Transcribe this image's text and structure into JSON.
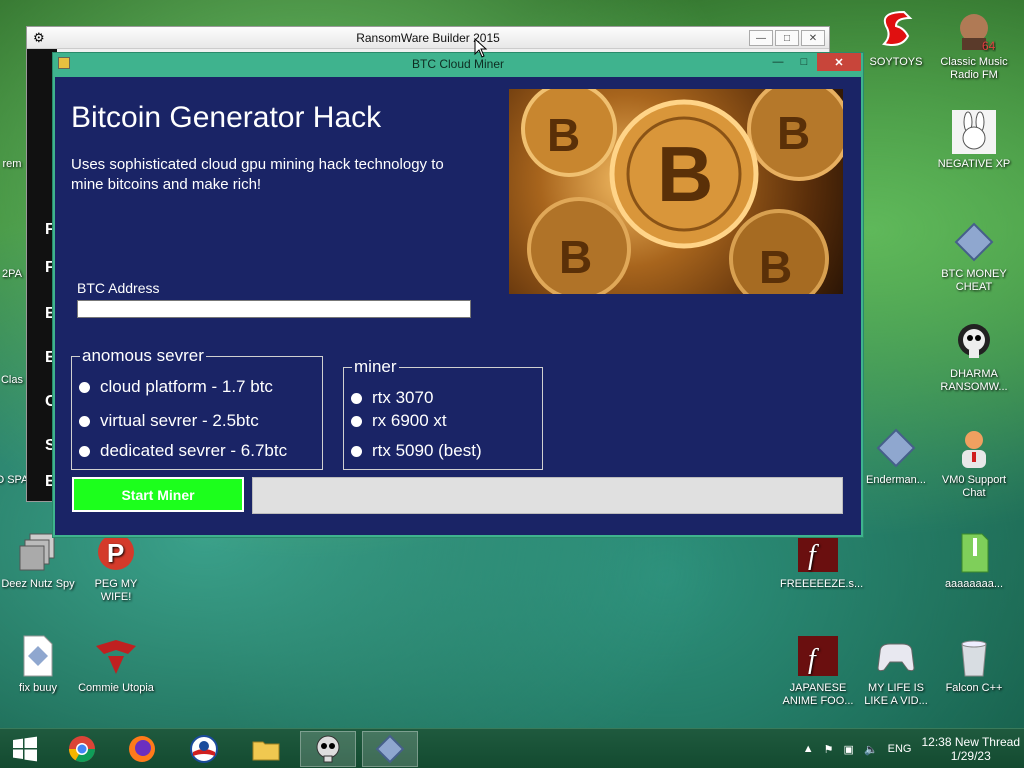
{
  "back_window": {
    "title": "RansomWare Builder 2015",
    "side_letters": [
      "F",
      "F",
      "E",
      "E",
      "C",
      "S",
      "E"
    ]
  },
  "window": {
    "title": "BTC Cloud Miner",
    "heading": "Bitcoin Generator Hack",
    "description": "Uses sophisticated cloud gpu mining hack technology to mine bitcoins and make rich!",
    "address_label": "BTC Address",
    "address_value": "",
    "server_group": {
      "legend": "anomous sevrer",
      "options": [
        "cloud platform - 1.7 btc",
        "virtual sevrer - 2.5btc",
        "dedicated sevrer - 6.7btc"
      ]
    },
    "miner_group": {
      "legend": "miner",
      "options": [
        "rtx 3070",
        "rx 6900 xt",
        "rtx 5090 (best)"
      ]
    },
    "start_button": "Start Miner",
    "progress": 0
  },
  "desktop_icons": {
    "left": [
      "rem",
      "2PA",
      "Clas",
      "CO SPAN",
      "Deez Nutz Spy",
      "PEG MY WIFE!",
      "fix buuy",
      "Commie Utopia"
    ],
    "right": [
      "SOYTOYS",
      "Classic Music Radio FM",
      "NEGATIVE XP",
      "BTC MONEY CHEAT",
      "DHARMA RANSOMW...",
      "Enderman...",
      "VM0 Support Chat",
      "FREEEEEZE.s...",
      "aaaaaaaa...",
      "JAPANESE ANIME FOO...",
      "MY LIFE IS LIKE A VID...",
      "Falcon C++"
    ]
  },
  "taskbar": {
    "language": "ENG",
    "time": "12:38 New Thread",
    "date": "1/29/23"
  },
  "colors": {
    "client_bg": "#1a2466",
    "window_frame": "#3fb38e",
    "start_button": "#1cff1c",
    "close_button": "#c8453a"
  }
}
